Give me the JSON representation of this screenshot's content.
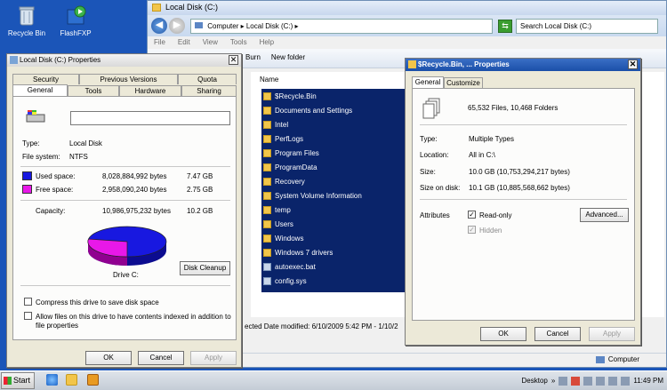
{
  "desktop": {
    "icons": [
      {
        "label": "Recycle Bin",
        "icon": "recycle-bin-icon"
      },
      {
        "label": "FlashFXP",
        "icon": "flashfxp-icon"
      }
    ]
  },
  "explorer": {
    "title": "Local Disk (C:)",
    "address": {
      "computer": "Computer",
      "drive": "Local Disk (C:)"
    },
    "search_placeholder": "Search Local Disk (C:)",
    "menu": [
      "File",
      "Edit",
      "View",
      "Tools",
      "Help"
    ],
    "toolbar": {
      "burn": "Burn",
      "new_folder": "New folder"
    },
    "column_name": "Name",
    "files": [
      {
        "name": "$Recycle.Bin",
        "type": "folder"
      },
      {
        "name": "Documents and Settings",
        "type": "folder"
      },
      {
        "name": "Intel",
        "type": "folder"
      },
      {
        "name": "PerfLogs",
        "type": "folder"
      },
      {
        "name": "Program Files",
        "type": "folder"
      },
      {
        "name": "ProgramData",
        "type": "folder"
      },
      {
        "name": "Recovery",
        "type": "folder"
      },
      {
        "name": "System Volume Information",
        "type": "folder"
      },
      {
        "name": "temp",
        "type": "folder"
      },
      {
        "name": "Users",
        "type": "folder"
      },
      {
        "name": "Windows",
        "type": "folder"
      },
      {
        "name": "Windows 7 drivers",
        "type": "folder"
      },
      {
        "name": "autoexec.bat",
        "type": "file"
      },
      {
        "name": "config.sys",
        "type": "file"
      }
    ],
    "details_text": "ected  Date modified: 6/10/2009 5:42 PM - 1/10/2",
    "status_computer": "Computer"
  },
  "disk_props": {
    "title": "Local Disk (C:) Properties",
    "tabs_top": [
      "Security",
      "Previous Versions",
      "Quota"
    ],
    "tabs_bottom": [
      "General",
      "Tools",
      "Hardware",
      "Sharing"
    ],
    "selected_tab": "General",
    "name_value": "",
    "type_label": "Type:",
    "type_value": "Local Disk",
    "fs_label": "File system:",
    "fs_value": "NTFS",
    "used_label": "Used space:",
    "used_bytes": "8,028,884,992 bytes",
    "used_gb": "7.47 GB",
    "free_label": "Free space:",
    "free_bytes": "2,958,090,240 bytes",
    "free_gb": "2.75 GB",
    "cap_label": "Capacity:",
    "cap_bytes": "10,986,975,232 bytes",
    "cap_gb": "10.2 GB",
    "drive_label": "Drive C:",
    "cleanup_button": "Disk Cleanup",
    "compress_label": "Compress this drive to save disk space",
    "index_label_1": "Allow files on this drive to have contents indexed in addition to",
    "index_label_2": "file properties",
    "ok": "OK",
    "cancel": "Cancel",
    "apply": "Apply",
    "used_color": "#1818e0",
    "free_color": "#e818e8"
  },
  "bin_props": {
    "title": "$Recycle.Bin, ... Properties",
    "tabs": [
      "General",
      "Customize"
    ],
    "summary": "65,532 Files, 10,468 Folders",
    "type_label": "Type:",
    "type_value": "Multiple Types",
    "loc_label": "Location:",
    "loc_value": "All in C:\\",
    "size_label": "Size:",
    "size_value": "10.0 GB (10,753,294,217 bytes)",
    "sod_label": "Size on disk:",
    "sod_value": "10.1 GB (10,885,568,662 bytes)",
    "attr_label": "Attributes",
    "readonly_label": "Read-only",
    "hidden_label": "Hidden",
    "advanced_button": "Advanced...",
    "ok": "OK",
    "cancel": "Cancel",
    "apply": "Apply"
  },
  "taskbar": {
    "start": "Start",
    "desktop_label": "Desktop",
    "time": "11:49 PM"
  }
}
